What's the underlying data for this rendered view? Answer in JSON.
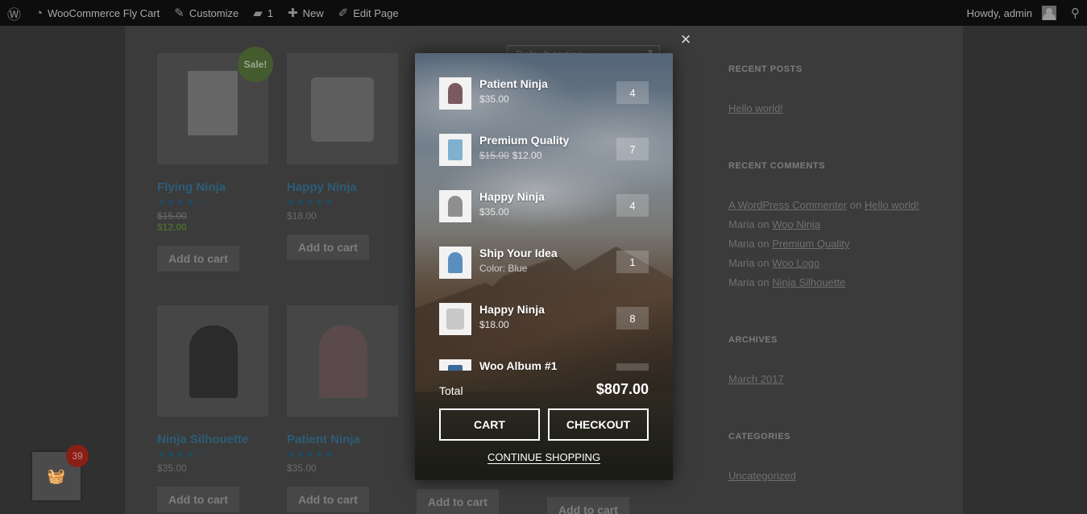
{
  "adminbar": {
    "site_name": "WooCommerce Fly Cart",
    "customize": "Customize",
    "comments_count": "1",
    "new_label": "New",
    "edit_page": "Edit Page",
    "howdy": "Howdy, admin"
  },
  "shop": {
    "sorting": "Default sorting",
    "products": [
      {
        "title": "Flying Ninja",
        "old_price": "$15.00",
        "price": "$12.00",
        "stars": "★★★★☆",
        "sale": "Sale!",
        "button": "Add to cart"
      },
      {
        "title": "Happy Ninja",
        "price": "$18.00",
        "stars": "★★★★★",
        "button": "Add to cart"
      },
      {
        "title": "Ninja Silhouette",
        "price": "$35.00",
        "stars": "★★★★☆",
        "button": "Add to cart"
      },
      {
        "title": "Patient Ninja",
        "price": "$35.00",
        "stars": "★★★★★",
        "button": "Add to cart"
      },
      {
        "button": "Add to cart"
      },
      {
        "button": "Add to cart"
      }
    ]
  },
  "sidebar": {
    "recent_posts_title": "RECENT POSTS",
    "recent_post": "Hello world!",
    "recent_comments_title": "RECENT COMMENTS",
    "comments": [
      {
        "author": "A WordPress Commenter",
        "on": "on",
        "post": "Hello world!"
      },
      {
        "author": "Maria",
        "on": "on",
        "post": "Woo Ninja"
      },
      {
        "author": "Maria",
        "on": "on",
        "post": "Premium Quality"
      },
      {
        "author": "Maria",
        "on": "on",
        "post": "Woo Logo"
      },
      {
        "author": "Maria",
        "on": "on",
        "post": "Ninja Silhouette"
      }
    ],
    "archives_title": "ARCHIVES",
    "archive": "March 2017",
    "categories_title": "CATEGORIES",
    "category": "Uncategorized"
  },
  "float_cart": {
    "count": "39"
  },
  "fly_cart": {
    "items": [
      {
        "name": "Patient Ninja",
        "price": "$35.00",
        "qty": "4",
        "color": "#7a5a60"
      },
      {
        "name": "Premium Quality",
        "old_price": "$15.00",
        "price": "$12.00",
        "qty": "7",
        "color": "#7fb0cf"
      },
      {
        "name": "Happy Ninja",
        "price": "$35.00",
        "qty": "4",
        "color": "#8f8f8f"
      },
      {
        "name": "Ship Your Idea",
        "price": "Color: Blue",
        "qty": "1",
        "color": "#5a8fc0"
      },
      {
        "name": "Happy Ninja",
        "price": "$18.00",
        "qty": "8",
        "color": "#c8c8c8"
      },
      {
        "name": "Woo Album #1",
        "price": "",
        "qty": "",
        "color": "#3a6a9a"
      }
    ],
    "total_label": "Total",
    "total_value": "$807.00",
    "cart_button": "CART",
    "checkout_button": "CHECKOUT",
    "continue_link": "CONTINUE SHOPPING"
  }
}
